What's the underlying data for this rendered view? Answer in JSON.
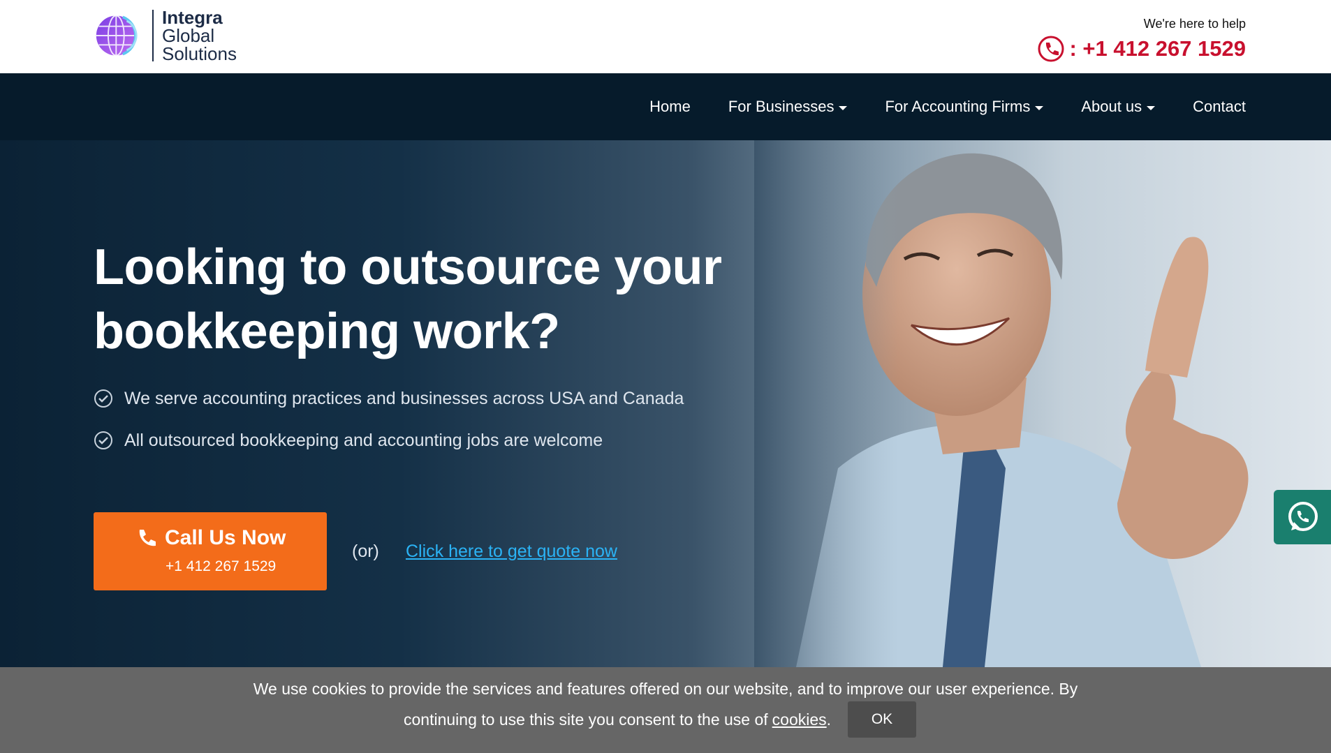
{
  "header": {
    "logo": {
      "line1": "Integra",
      "line2": "Global",
      "line3": "Solutions"
    },
    "help_text": "We're here to help",
    "phone": ": +1 412 267 1529"
  },
  "nav": {
    "items": [
      {
        "label": "Home",
        "dropdown": false
      },
      {
        "label": "For Businesses",
        "dropdown": true
      },
      {
        "label": "For Accounting Firms",
        "dropdown": true
      },
      {
        "label": "About us",
        "dropdown": true
      },
      {
        "label": "Contact",
        "dropdown": false
      }
    ]
  },
  "hero": {
    "title_line1": "Looking to outsource your",
    "title_line2": "bookkeeping work?",
    "bullets": [
      "We serve accounting practices and businesses across USA and Canada",
      "All outsourced bookkeeping and accounting jobs are welcome"
    ],
    "cta_title": "Call Us Now",
    "cta_phone": "+1 412 267 1529",
    "or_text": "(or)",
    "quote_link": "Click here to get quote now"
  },
  "cookie": {
    "line1": "We use cookies to provide the services and features offered on our website, and to improve our user experience. By",
    "line2": "continuing to use this site you consent to the use of",
    "link": "cookies",
    "period": ".",
    "ok": "OK"
  },
  "colors": {
    "nav_bg": "#061b2b",
    "phone_red": "#c8102e",
    "cta_orange": "#f36c1a",
    "link_blue": "#2bb3f5",
    "whatsapp_green": "#1a7f6e",
    "cookie_bg": "#666666"
  }
}
